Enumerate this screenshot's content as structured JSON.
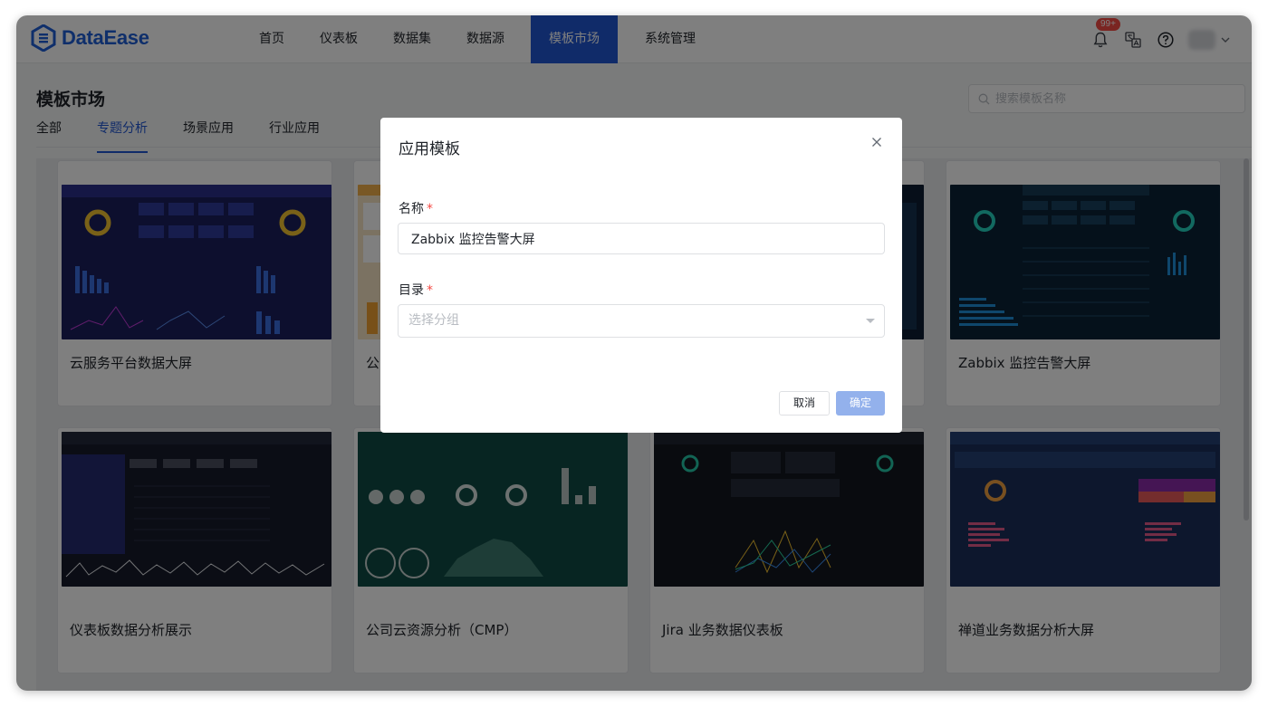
{
  "app": {
    "logo_text": "DataEase"
  },
  "nav": {
    "items": [
      {
        "label": "首页"
      },
      {
        "label": "仪表板"
      },
      {
        "label": "数据集"
      },
      {
        "label": "数据源"
      },
      {
        "label": "模板市场",
        "active": true
      },
      {
        "label": "系统管理"
      }
    ]
  },
  "header": {
    "notification_badge": "99+",
    "icons": [
      "bell-icon",
      "translate-icon",
      "help-icon",
      "chevron-down-icon"
    ]
  },
  "page": {
    "title": "模板市场",
    "search_placeholder": "搜索模板名称",
    "tabs": [
      {
        "label": "全部"
      },
      {
        "label": "专题分析",
        "active": true
      },
      {
        "label": "场景应用"
      },
      {
        "label": "行业应用"
      }
    ]
  },
  "cards": [
    {
      "name": "云服务平台数据大屏",
      "theme": "#1a1f5c"
    },
    {
      "name": "公",
      "theme": "#f3b04a"
    },
    {
      "name": "",
      "theme": "#0d1c33"
    },
    {
      "name": "Zabbix 监控告警大屏",
      "theme": "#0b2236"
    },
    {
      "name": "仪表板数据分析展示",
      "theme": "#161b2b"
    },
    {
      "name": "公司云资源分析（CMP）",
      "theme": "#0f4a44"
    },
    {
      "name": "Jira 业务数据仪表板",
      "theme": "#13171f"
    },
    {
      "name": "禅道业务数据分析大屏",
      "theme": "#1a2f5a"
    }
  ],
  "modal": {
    "title": "应用模板",
    "name_label": "名称",
    "name_value": "Zabbix 监控告警大屏",
    "dir_label": "目录",
    "dir_placeholder": "选择分组",
    "required_mark": "*",
    "cancel_label": "取消",
    "confirm_label": "确定"
  },
  "colors": {
    "brand": "#2156d2",
    "required": "#f54a45",
    "badge": "#f54a45"
  }
}
